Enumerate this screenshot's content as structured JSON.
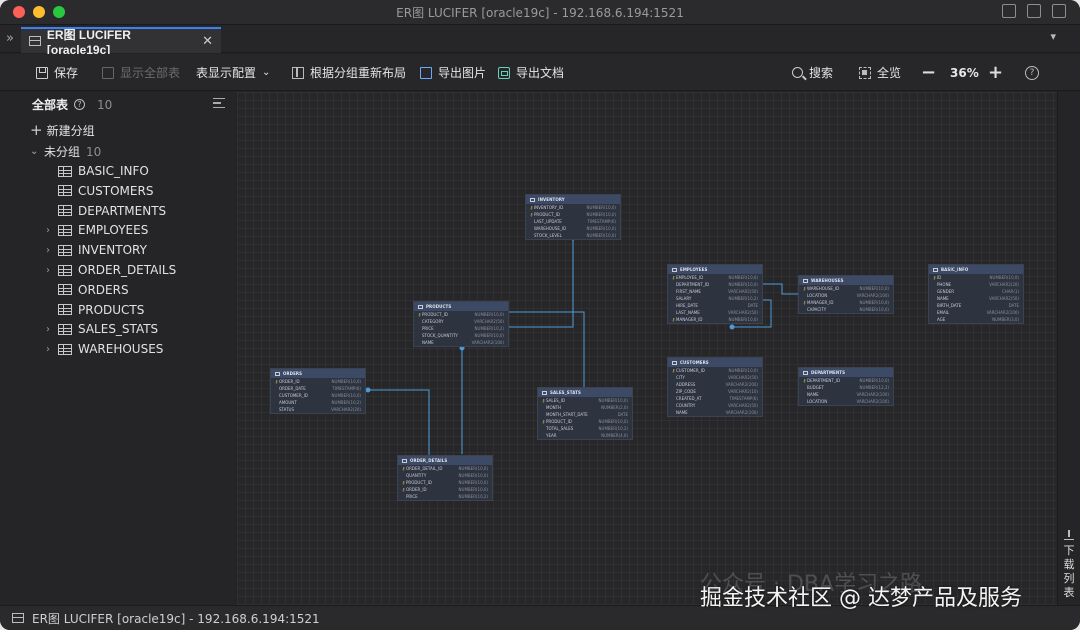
{
  "window": {
    "title": "ER图 LUCIFER [oracle19c] - 192.168.6.194:1521"
  },
  "tab": {
    "label": "ER图 LUCIFER [oracle19c]",
    "close": "✕"
  },
  "toolbar": {
    "save": "保存",
    "show_all": "显示全部表",
    "display_config": "表显示配置",
    "relayout": "根据分组重新布局",
    "export_image": "导出图片",
    "export_doc": "导出文档",
    "search": "搜索",
    "fit": "全览",
    "zoom": "36%"
  },
  "sidebar": {
    "header": "全部表",
    "count": "10",
    "new_group": "新建分组",
    "ungrouped": {
      "label": "未分组",
      "count": "10"
    },
    "tables": [
      "BASIC_INFO",
      "CUSTOMERS",
      "DEPARTMENTS",
      "EMPLOYEES",
      "INVENTORY",
      "ORDER_DETAILS",
      "ORDERS",
      "PRODUCTS",
      "SALES_STATS",
      "WAREHOUSES"
    ]
  },
  "entities": {
    "inventory": {
      "name": "INVENTORY",
      "cols": [
        [
          "INVENTORY_ID",
          "NUMBER(10,0)"
        ],
        [
          "PRODUCT_ID",
          "NUMBER(10,0)"
        ],
        [
          "LAST_UPDATE",
          "TIMESTAMP(6)"
        ],
        [
          "WAREHOUSE_ID",
          "NUMBER(10,0)"
        ],
        [
          "STOCK_LEVEL",
          "NUMBER(10,0)"
        ]
      ]
    },
    "products": {
      "name": "PRODUCTS",
      "cols": [
        [
          "PRODUCT_ID",
          "NUMBER(10,0)"
        ],
        [
          "CATEGORY",
          "VARCHAR2(50)"
        ],
        [
          "PRICE",
          "NUMBER(10,2)"
        ],
        [
          "STOCK_QUANTITY",
          "NUMBER(10,0)"
        ],
        [
          "NAME",
          "VARCHAR2(100)"
        ]
      ]
    },
    "orders": {
      "name": "ORDERS",
      "cols": [
        [
          "ORDER_ID",
          "NUMBER(10,0)"
        ],
        [
          "ORDER_DATE",
          "TIMESTAMP(6)"
        ],
        [
          "CUSTOMER_ID",
          "NUMBER(10,0)"
        ],
        [
          "AMOUNT",
          "NUMBER(10,2)"
        ],
        [
          "STATUS",
          "VARCHAR2(20)"
        ]
      ]
    },
    "order_details": {
      "name": "ORDER_DETAILS",
      "cols": [
        [
          "ORDER_DETAIL_ID",
          "NUMBER(10,0)"
        ],
        [
          "QUANTITY",
          "NUMBER(10,0)"
        ],
        [
          "PRODUCT_ID",
          "NUMBER(10,0)"
        ],
        [
          "ORDER_ID",
          "NUMBER(10,0)"
        ],
        [
          "PRICE",
          "NUMBER(10,2)"
        ]
      ]
    },
    "sales_stats": {
      "name": "SALES_STATS",
      "cols": [
        [
          "SALES_ID",
          "NUMBER(10,0)"
        ],
        [
          "MONTH",
          "NUMBER(2,0)"
        ],
        [
          "MONTH_START_DATE",
          "DATE"
        ],
        [
          "PRODUCT_ID",
          "NUMBER(10,0)"
        ],
        [
          "TOTAL_SALES",
          "NUMBER(10,2)"
        ],
        [
          "YEAR",
          "NUMBER(4,0)"
        ]
      ]
    },
    "employees": {
      "name": "EMPLOYEES",
      "cols": [
        [
          "EMPLOYEE_ID",
          "NUMBER(10,0)"
        ],
        [
          "DEPARTMENT_ID",
          "NUMBER(10,0)"
        ],
        [
          "FIRST_NAME",
          "VARCHAR2(50)"
        ],
        [
          "SALARY",
          "NUMBER(10,2)"
        ],
        [
          "HIRE_DATE",
          "DATE"
        ],
        [
          "LAST_NAME",
          "VARCHAR2(50)"
        ],
        [
          "MANAGER_ID",
          "NUMBER(10,0)"
        ]
      ]
    },
    "warehouses": {
      "name": "WAREHOUSES",
      "cols": [
        [
          "WAREHOUSE_ID",
          "NUMBER(10,0)"
        ],
        [
          "LOCATION",
          "VARCHAR2(100)"
        ],
        [
          "MANAGER_ID",
          "NUMBER(10,0)"
        ],
        [
          "CAPACITY",
          "NUMBER(10,0)"
        ]
      ]
    },
    "basic_info": {
      "name": "BASIC_INFO",
      "cols": [
        [
          "ID",
          "NUMBER(10,0)"
        ],
        [
          "PHONE",
          "VARCHAR2(20)"
        ],
        [
          "GENDER",
          "CHAR(1)"
        ],
        [
          "NAME",
          "VARCHAR2(50)"
        ],
        [
          "BIRTH_DATE",
          "DATE"
        ],
        [
          "EMAIL",
          "VARCHAR2(100)"
        ],
        [
          "AGE",
          "NUMBER(3,0)"
        ]
      ]
    },
    "customers": {
      "name": "CUSTOMERS",
      "cols": [
        [
          "CUSTOMER_ID",
          "NUMBER(10,0)"
        ],
        [
          "CITY",
          "VARCHAR2(50)"
        ],
        [
          "ADDRESS",
          "VARCHAR2(200)"
        ],
        [
          "ZIP_CODE",
          "VARCHAR2(10)"
        ],
        [
          "CREATED_AT",
          "TIMESTAMP(6)"
        ],
        [
          "COUNTRY",
          "VARCHAR2(50)"
        ],
        [
          "NAME",
          "VARCHAR2(100)"
        ]
      ]
    },
    "departments": {
      "name": "DEPARTMENTS",
      "cols": [
        [
          "DEPARTMENT_ID",
          "NUMBER(10,0)"
        ],
        [
          "BUDGET",
          "NUMBER(12,2)"
        ],
        [
          "NAME",
          "VARCHAR2(100)"
        ],
        [
          "LOCATION",
          "VARCHAR2(100)"
        ]
      ]
    }
  },
  "right_panel": {
    "download_list": "下载列表"
  },
  "status": {
    "text": "ER图 LUCIFER [oracle19c] - 192.168.6.194:1521"
  },
  "watermark": {
    "line1": "公众号 · DBA学习之路",
    "line2": "掘金技术社区 @ 达梦产品及服务"
  },
  "colors": {
    "accent": "#3e7ff2",
    "entity_header": "#3c4a66",
    "link": "#4d9bd6"
  }
}
